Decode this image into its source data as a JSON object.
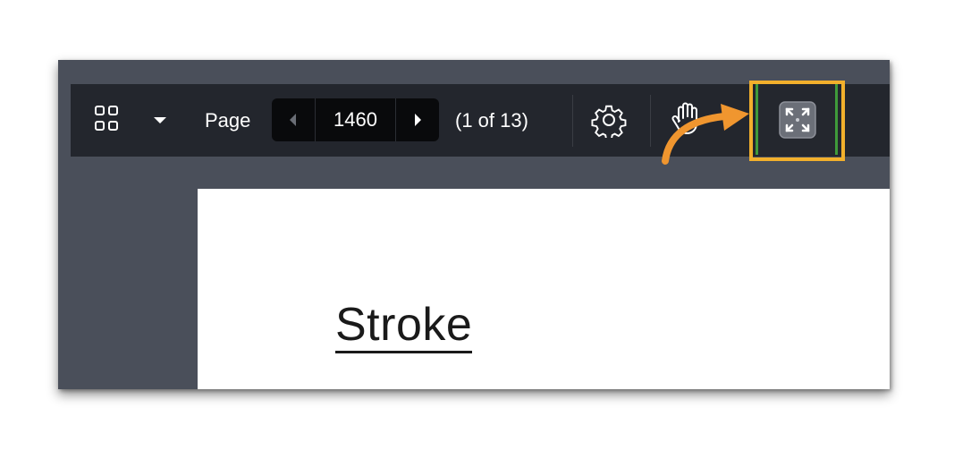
{
  "toolbar": {
    "grid_icon": "grid-view-icon",
    "caret_icon": "caret-down-icon",
    "page_label": "Page",
    "page_value": "1460",
    "page_count": "(1 of 13)",
    "settings_icon": "gear-icon",
    "pan_icon": "hand-icon",
    "fullscreen_icon": "fullscreen-expand-icon"
  },
  "document": {
    "heading": "Stroke"
  },
  "annotation": {
    "highlight_color": "#f2b02c",
    "arrow_color": "#f0962f"
  }
}
